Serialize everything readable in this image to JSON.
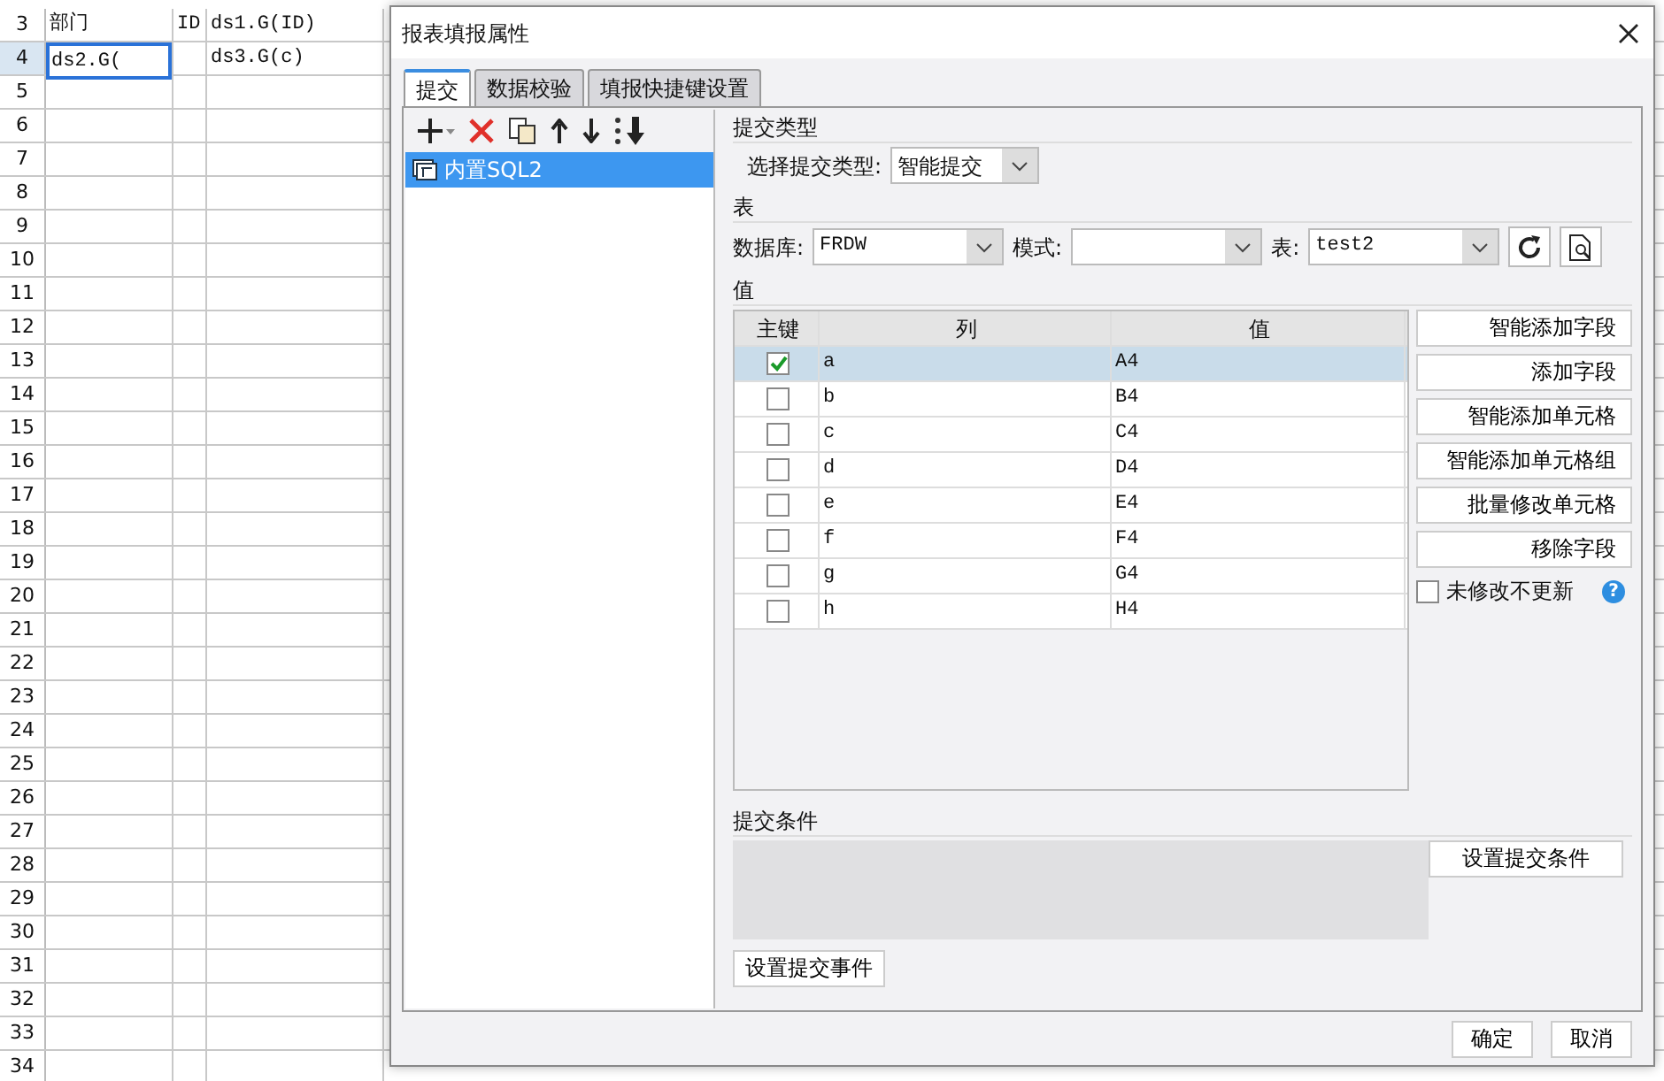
{
  "sheet": {
    "rows": [
      {
        "number": "3",
        "header_selected": false,
        "cells": [
          {
            "text": "部门",
            "selected": false
          },
          {
            "text": "ID",
            "selected": false
          },
          {
            "text": "ds1.G(ID)",
            "selected": false
          }
        ]
      },
      {
        "number": "4",
        "header_selected": true,
        "cells": [
          {
            "text": "ds2.G(",
            "selected": true
          },
          {
            "selected": false
          },
          {
            "text": "ds3.G(c)",
            "selected": false
          }
        ]
      },
      {
        "number": "5"
      },
      {
        "number": "6"
      },
      {
        "number": "7"
      },
      {
        "number": "8"
      },
      {
        "number": "9"
      },
      {
        "number": "10"
      },
      {
        "number": "11"
      },
      {
        "number": "12"
      },
      {
        "number": "13"
      },
      {
        "number": "14"
      },
      {
        "number": "15"
      },
      {
        "number": "16"
      },
      {
        "number": "17"
      },
      {
        "number": "18"
      },
      {
        "number": "19"
      },
      {
        "number": "20"
      },
      {
        "number": "21"
      },
      {
        "number": "22"
      },
      {
        "number": "23"
      },
      {
        "number": "24"
      },
      {
        "number": "25"
      },
      {
        "number": "26"
      },
      {
        "number": "27"
      },
      {
        "number": "28"
      },
      {
        "number": "29"
      },
      {
        "number": "30"
      },
      {
        "number": "31"
      },
      {
        "number": "32"
      },
      {
        "number": "33"
      },
      {
        "number": "34"
      }
    ]
  },
  "dialog": {
    "title": "报表填报属性",
    "tabs": [
      {
        "label": "提交",
        "selected": true
      },
      {
        "label": "数据校验",
        "selected": false
      },
      {
        "label": "填报快捷键设置",
        "selected": false
      }
    ],
    "list_items": [
      {
        "label": "内置SQL2",
        "selected": true
      }
    ],
    "submit_type": {
      "heading": "提交类型",
      "label": "选择提交类型:",
      "value": "智能提交"
    },
    "table_section": {
      "heading": "表",
      "database_label": "数据库:",
      "database": "FRDW",
      "schema_label": "模式:",
      "table_label": "表:",
      "table": "test2"
    },
    "values": {
      "heading": "值",
      "columns": [
        "主键",
        "列",
        "值"
      ],
      "rows": [
        {
          "key": true,
          "column": "a",
          "value": "A4",
          "selected": true
        },
        {
          "key": false,
          "column": "b",
          "value": "B4",
          "selected": false
        },
        {
          "key": false,
          "column": "c",
          "value": "C4",
          "selected": false
        },
        {
          "key": false,
          "column": "d",
          "value": "D4",
          "selected": false
        },
        {
          "key": false,
          "column": "e",
          "value": "E4",
          "selected": false
        },
        {
          "key": false,
          "column": "f",
          "value": "F4",
          "selected": false
        },
        {
          "key": false,
          "column": "g",
          "value": "G4",
          "selected": false
        },
        {
          "key": false,
          "column": "h",
          "value": "H4",
          "selected": false
        }
      ],
      "buttons": [
        "智能添加字段",
        "添加字段",
        "智能添加单元格",
        "智能添加单元格组",
        "批量修改单元格",
        "移除字段"
      ],
      "skip_unchanged": {
        "label": "未修改不更新",
        "checked": false
      },
      "help": "?"
    },
    "condition": {
      "heading": "提交条件",
      "button": "设置提交条件"
    },
    "event_button": "设置提交事件",
    "footer_buttons": [
      "确定",
      "取消"
    ]
  }
}
